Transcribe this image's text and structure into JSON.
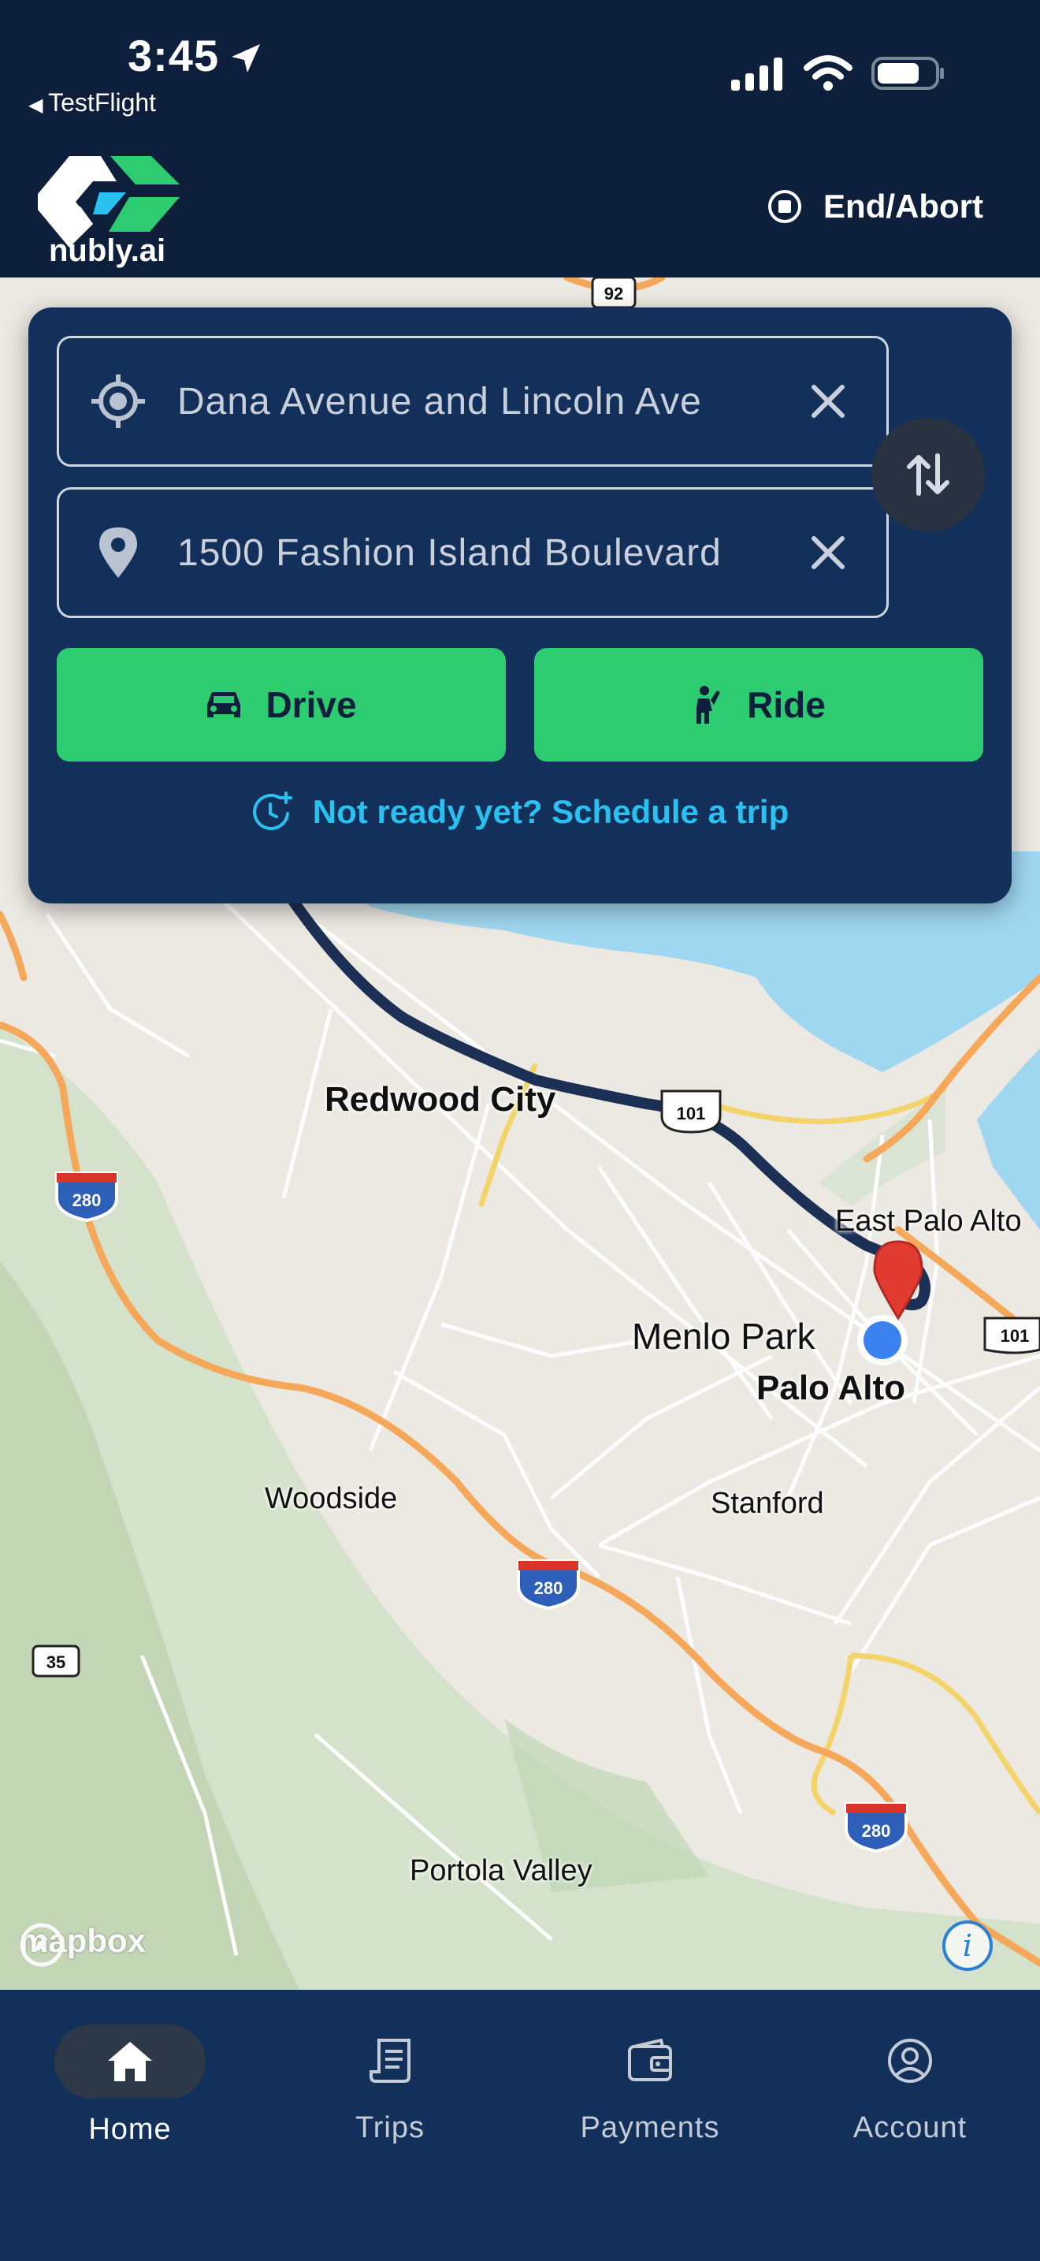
{
  "status_bar": {
    "time": "3:45",
    "back_app": "TestFlight",
    "icons": [
      "location-arrow-icon",
      "cellular-signal-icon",
      "wifi-icon",
      "battery-icon"
    ]
  },
  "header": {
    "logo_text": "nubly.ai",
    "end_abort_label": "End/Abort"
  },
  "trip_form": {
    "origin": {
      "value": "Dana Avenue and Lincoln Ave",
      "icon": "my-location-icon"
    },
    "destination": {
      "value": "1500 Fashion Island Boulevard",
      "icon": "map-pin-icon"
    },
    "drive_label": "Drive",
    "ride_label": "Ride",
    "schedule_label": "Not ready yet? Schedule a trip"
  },
  "map": {
    "labels": {
      "redwood_city": "Redwood City",
      "east_palo_alto": "East Palo Alto",
      "menlo_park": "Menlo Park",
      "palo_alto": "Palo Alto",
      "woodside": "Woodside",
      "stanford": "Stanford",
      "portola_valley": "Portola Valley"
    },
    "shields": {
      "i280_a": "280",
      "i280_b": "280",
      "i280_c": "280",
      "us101_a": "101",
      "us101_b": "101",
      "ca92": "92",
      "ca35": "35"
    },
    "attribution": "mapbox",
    "colors": {
      "route": "#1c2f55",
      "destination_pin": "#e23b32",
      "current_location": "#3b82f0"
    }
  },
  "nav": {
    "items": [
      {
        "label": "Home",
        "icon": "home-icon",
        "active": true
      },
      {
        "label": "Trips",
        "icon": "receipt-icon",
        "active": false
      },
      {
        "label": "Payments",
        "icon": "wallet-icon",
        "active": false
      },
      {
        "label": "Account",
        "icon": "account-icon",
        "active": false
      }
    ]
  },
  "colors": {
    "brand_green": "#2ecc71",
    "navy": "#13305a",
    "link_cyan": "#29c1f0"
  }
}
